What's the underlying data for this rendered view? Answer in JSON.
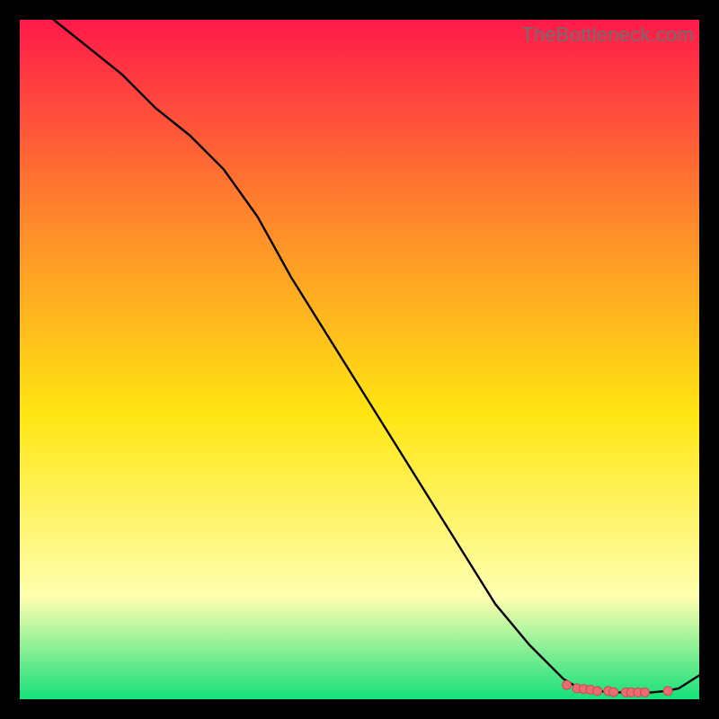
{
  "watermark": "TheBottleneck.com",
  "colors": {
    "frame": "#000000",
    "gradient_top": "#ff1a4a",
    "gradient_mid_upper": "#ff8a2a",
    "gradient_mid": "#ffe612",
    "gradient_lower": "#ffffb0",
    "gradient_bottom": "#15e07a",
    "line": "#000000",
    "dot_fill": "#ee6b72",
    "dot_stroke": "#c84a52"
  },
  "chart_data": {
    "type": "line",
    "title": "",
    "xlabel": "",
    "ylabel": "",
    "xlim": [
      0,
      100
    ],
    "ylim": [
      0,
      100
    ],
    "series": [
      {
        "name": "curve",
        "x": [
          0,
          5,
          10,
          15,
          20,
          25,
          30,
          35,
          40,
          45,
          50,
          55,
          60,
          65,
          70,
          75,
          80,
          82,
          85,
          88,
          90,
          93,
          95,
          97,
          100
        ],
        "y": [
          103,
          100,
          96,
          92,
          87,
          83,
          78,
          71,
          62,
          54,
          46,
          38,
          30,
          22,
          14,
          8,
          3,
          1.8,
          1.2,
          1.0,
          1.0,
          1.0,
          1.2,
          1.6,
          3.5
        ]
      }
    ],
    "dots": {
      "name": "markers",
      "x": [
        80.5,
        82.0,
        83.0,
        84.0,
        85.0,
        86.6,
        87.4,
        89.2,
        90.0,
        91.0,
        92.0,
        95.4
      ],
      "y": [
        2.1,
        1.6,
        1.5,
        1.4,
        1.2,
        1.2,
        1.05,
        1.0,
        1.0,
        1.0,
        1.0,
        1.2
      ]
    }
  }
}
